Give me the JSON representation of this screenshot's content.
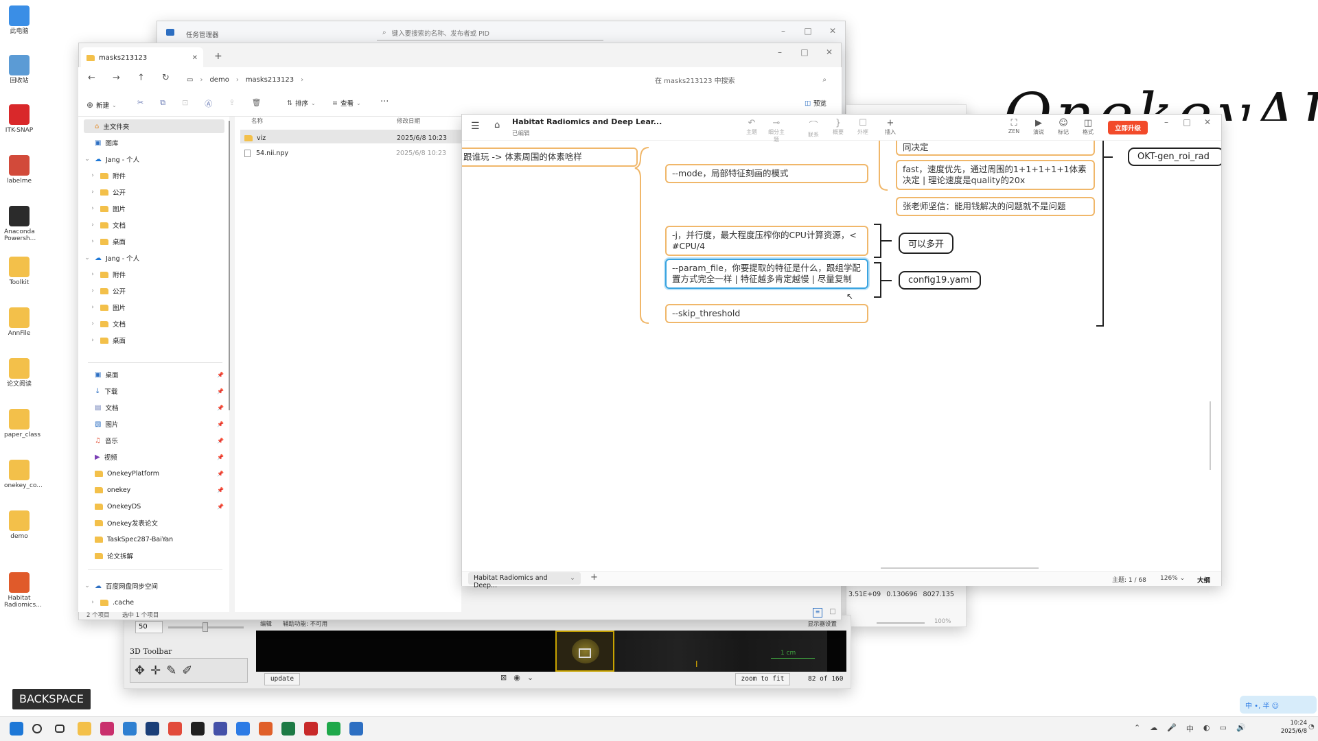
{
  "desktop": {
    "icons": [
      {
        "label": "此电脑",
        "color": "#3a8ee6"
      },
      {
        "label": "回收站",
        "color": "#5b9bd5"
      },
      {
        "label": "ITK-SNAP",
        "color": "#d9282a"
      },
      {
        "label": "labelme",
        "color": "#d24a3a"
      },
      {
        "label": "Anaconda Powersh...",
        "color": "#2b2b2b"
      },
      {
        "label": "Toolkit",
        "color": "#f3c04a"
      },
      {
        "label": "AnnFile",
        "color": "#f3c04a"
      },
      {
        "label": "论文阅读",
        "color": "#f3c04a"
      },
      {
        "label": "paper_class",
        "color": "#f3c04a"
      },
      {
        "label": "onekey_co...",
        "color": "#f3c04a"
      },
      {
        "label": "demo",
        "color": "#f3c04a"
      },
      {
        "label": "Habitat Radiomics...",
        "color": "#e05a2a"
      }
    ],
    "watermark": "OnekeyAI",
    "backspace_badge": "BACKSPACE",
    "ime_badge": "中 •, 半 ☺"
  },
  "task_manager": {
    "title": "任务管理器",
    "search_placeholder": "键入要搜索的名称、发布者或 PID"
  },
  "file_explorer": {
    "tab_title": "masks213123",
    "breadcrumb": [
      "demo",
      "masks213123"
    ],
    "search_placeholder": "在 masks213123 中搜索",
    "toolbar": {
      "new": "新建",
      "sort": "排序",
      "view": "查看",
      "more": "···",
      "preview": "预览"
    },
    "sidebar": [
      {
        "label": "主文件夹",
        "kind": "home",
        "indent": 0,
        "selected": true
      },
      {
        "label": "图库",
        "kind": "gallery",
        "indent": 0
      },
      {
        "label": "Jang - 个人",
        "kind": "cloud",
        "indent": 0,
        "expanded": true
      },
      {
        "label": "附件",
        "kind": "folder",
        "indent": 1
      },
      {
        "label": "公开",
        "kind": "folder",
        "indent": 1
      },
      {
        "label": "图片",
        "kind": "folder",
        "indent": 1
      },
      {
        "label": "文档",
        "kind": "folder",
        "indent": 1
      },
      {
        "label": "桌面",
        "kind": "folder",
        "indent": 1
      },
      {
        "label": "Jang - 个人",
        "kind": "cloud",
        "indent": 0,
        "expanded": true
      },
      {
        "label": "附件",
        "kind": "folder",
        "indent": 1
      },
      {
        "label": "公开",
        "kind": "folder",
        "indent": 1
      },
      {
        "label": "图片",
        "kind": "folder",
        "indent": 1
      },
      {
        "label": "文档",
        "kind": "folder",
        "indent": 1
      },
      {
        "label": "桌面",
        "kind": "folder",
        "indent": 1
      }
    ],
    "quick_access": [
      {
        "label": "桌面",
        "kind": "desktop"
      },
      {
        "label": "下载",
        "kind": "download"
      },
      {
        "label": "文档",
        "kind": "docs"
      },
      {
        "label": "图片",
        "kind": "pics"
      },
      {
        "label": "音乐",
        "kind": "music"
      },
      {
        "label": "视频",
        "kind": "video"
      },
      {
        "label": "OnekeyPlatform",
        "kind": "folder"
      },
      {
        "label": "onekey",
        "kind": "folder"
      },
      {
        "label": "OnekeyDS",
        "kind": "folder"
      },
      {
        "label": "Onekey发表论文",
        "kind": "folder"
      },
      {
        "label": "TaskSpec287-BaiYan",
        "kind": "folder"
      },
      {
        "label": "论文拆解",
        "kind": "folder"
      }
    ],
    "bottom_tree": [
      {
        "label": "百度网盘同步空间",
        "kind": "cloud"
      },
      {
        "label": ".cache",
        "kind": "folder"
      }
    ],
    "columns": {
      "name": "名称",
      "date": "修改日期"
    },
    "files": [
      {
        "name": "viz",
        "date": "2025/6/8 10:23",
        "kind": "folder"
      },
      {
        "name": "54.nii.npy",
        "date": "2025/6/8 10:23",
        "kind": "file"
      }
    ],
    "status_left": "2 个项目",
    "status_right": "选中 1 个项目"
  },
  "itk_snap": {
    "slider_value": "50",
    "toolbar_label": "3D Toolbar",
    "update_button": "update",
    "zoom_button": "zoom to fit",
    "slice_counter": "82 of 160",
    "scale_bar": "1 cm",
    "status_a": "编辑",
    "status_b": "辅助功能: 不可用",
    "status_c": "显示器设置",
    "readout_values": [
      "3.51E+09",
      "0.130696",
      "8027.135"
    ],
    "zoom_level": "100%"
  },
  "mindmap": {
    "title": "Habitat Radiomics and Deep Lear...",
    "subtitle": "已编辑",
    "toolbar": [
      {
        "icon": "↶",
        "label": "主题"
      },
      {
        "icon": "⊸",
        "label": "细分主题"
      },
      {
        "icon": "⌒",
        "label": "联系"
      },
      {
        "icon": "}",
        "label": "概要"
      },
      {
        "icon": "☐",
        "label": "外框"
      },
      {
        "icon": "+",
        "label": "插入"
      },
      {
        "icon": "⛶",
        "label": "ZEN"
      },
      {
        "icon": "▶",
        "label": "演说"
      },
      {
        "icon": "☺",
        "label": "标记"
      },
      {
        "icon": "◫",
        "label": "格式"
      }
    ],
    "upgrade_button": "立即升级",
    "nodes": {
      "left_topic": "跟谁玩 -> 体素周围的体素啥样",
      "mode": "--mode，局部特征刻画的模式",
      "top_cut": "同决定",
      "fast": "fast，速度优先，通过周围的1+1+1+1+1体素决定 | 理论速度是quality的20x",
      "zhang": "张老师坚信：能用钱解决的问题就不是问题",
      "j_param": "-j，并行度，最大程度压榨你的CPU计算资源，< #CPU/4",
      "param_file": "--param_file，你要提取的特征是什么，跟组学配置方式完全一样 | 特征越多肯定越慢 | 尽量复制",
      "skip": "--skip_threshold",
      "multi": "可以多开",
      "config": "config19.yaml",
      "okt": "OKT-gen_roi_rad"
    },
    "sheet_tab": "Habitat Radiomics and Deep...",
    "topic_count": "主题: 1 / 68",
    "zoom": "126%",
    "outline": "大纲"
  },
  "taskbar": {
    "time": "10:24",
    "date": "2025/6/8",
    "apps": [
      {
        "name": "start-icon",
        "color": "#1e78d7"
      },
      {
        "name": "search-icon",
        "color": "#333333"
      },
      {
        "name": "task-view-icon",
        "color": "#333333"
      },
      {
        "name": "file-explorer-icon",
        "color": "#f3c04a"
      },
      {
        "name": "itk-snap-app-icon",
        "color": "#c9306d"
      },
      {
        "name": "vscode-icon",
        "color": "#2f80d1"
      },
      {
        "name": "terminal-icon",
        "color": "#1b3f78"
      },
      {
        "name": "chrome-icon",
        "color": "#e24b3b"
      },
      {
        "name": "screen-recorder-icon",
        "color": "#202020"
      },
      {
        "name": "onekey-icon",
        "color": "#4451a8"
      },
      {
        "name": "app-icon",
        "color": "#2c7be5"
      },
      {
        "name": "habitat-icon",
        "color": "#e0602a"
      },
      {
        "name": "excel-icon",
        "color": "#1d7a45"
      },
      {
        "name": "itk-icon",
        "color": "#c82a2a"
      },
      {
        "name": "wechat-icon",
        "color": "#1fa84a"
      },
      {
        "name": "task-manager-icon",
        "color": "#2d6fc2"
      }
    ]
  }
}
